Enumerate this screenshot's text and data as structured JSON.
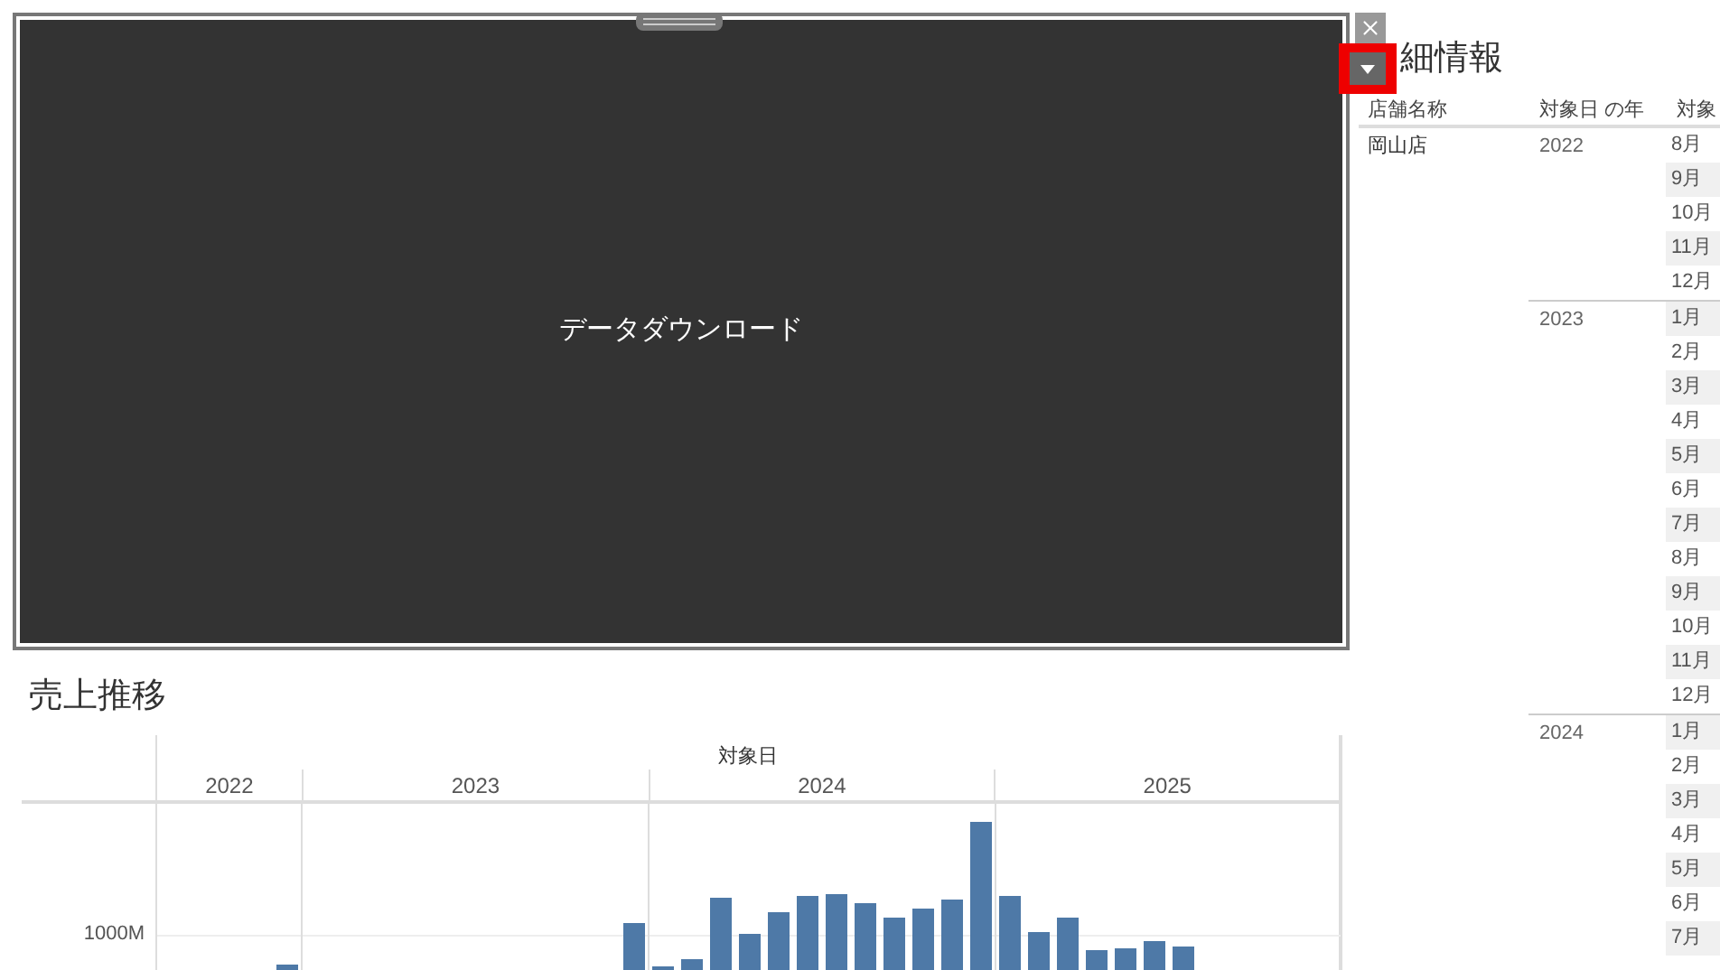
{
  "download_panel": {
    "label": "データダウンロード"
  },
  "detail": {
    "title": "細情報",
    "columns": [
      "店舗名称",
      "対象日 の年",
      "対象"
    ],
    "store": "岡山店",
    "groups": [
      {
        "year": "2022",
        "months": [
          "8月",
          "9月",
          "10月",
          "11月",
          "12月"
        ]
      },
      {
        "year": "2023",
        "months": [
          "1月",
          "2月",
          "3月",
          "4月",
          "5月",
          "6月",
          "7月",
          "8月",
          "9月",
          "10月",
          "11月",
          "12月"
        ]
      },
      {
        "year": "2024",
        "months": [
          "1月",
          "2月",
          "3月",
          "4月",
          "5月",
          "6月",
          "7月"
        ]
      }
    ]
  },
  "sales_chart": {
    "title": "売上推移",
    "axis_title": "対象日",
    "years": [
      "2022",
      "2023",
      "2024",
      "2025"
    ],
    "ytick": "1000M"
  }
}
